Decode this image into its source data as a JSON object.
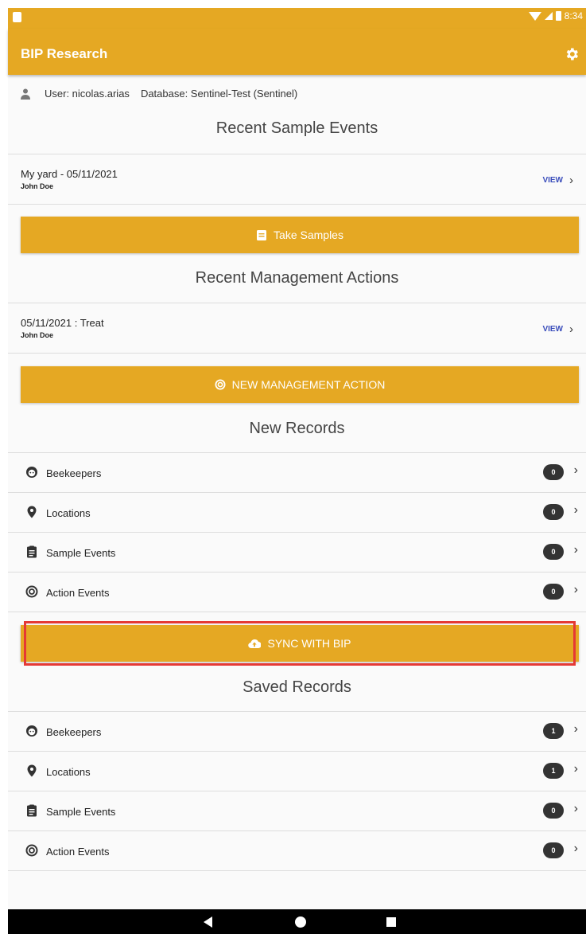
{
  "status_bar": {
    "time": "8:34"
  },
  "app_bar": {
    "title": "BIP Research",
    "settings_icon": "gear-icon"
  },
  "user_info": {
    "user": "User: nicolas.arias",
    "database": "Database: Sentinel-Test (Sentinel)"
  },
  "recent_samples": {
    "title": "Recent Sample Events",
    "items": [
      {
        "main": "My yard - 05/11/2021",
        "sub": "John Doe",
        "action": "VIEW"
      }
    ],
    "button_label": "Take Samples"
  },
  "recent_actions": {
    "title": "Recent Management Actions",
    "items": [
      {
        "main": "05/11/2021 : Treat",
        "sub": "John Doe",
        "action": "VIEW"
      }
    ],
    "button_label": "NEW MANAGEMENT ACTION"
  },
  "new_records": {
    "title": "New Records",
    "items": [
      {
        "label": "Beekeepers",
        "count": "0",
        "icon": "beekeeper-icon"
      },
      {
        "label": "Locations",
        "count": "0",
        "icon": "location-pin-icon"
      },
      {
        "label": "Sample Events",
        "count": "0",
        "icon": "clipboard-icon"
      },
      {
        "label": "Action Events",
        "count": "0",
        "icon": "spiral-icon"
      }
    ]
  },
  "sync": {
    "button_label": "SYNC WITH BIP",
    "icon": "cloud-upload-icon"
  },
  "saved_records": {
    "title": "Saved Records",
    "items": [
      {
        "label": "Beekeepers",
        "count": "1",
        "icon": "beekeeper-icon"
      },
      {
        "label": "Locations",
        "count": "1",
        "icon": "location-pin-icon"
      },
      {
        "label": "Sample Events",
        "count": "0",
        "icon": "clipboard-icon"
      },
      {
        "label": "Action Events",
        "count": "0",
        "icon": "spiral-icon"
      }
    ]
  },
  "colors": {
    "primary": "#e5a823",
    "highlight": "#e53935",
    "badge": "#333333",
    "link": "#3a4dbb"
  }
}
